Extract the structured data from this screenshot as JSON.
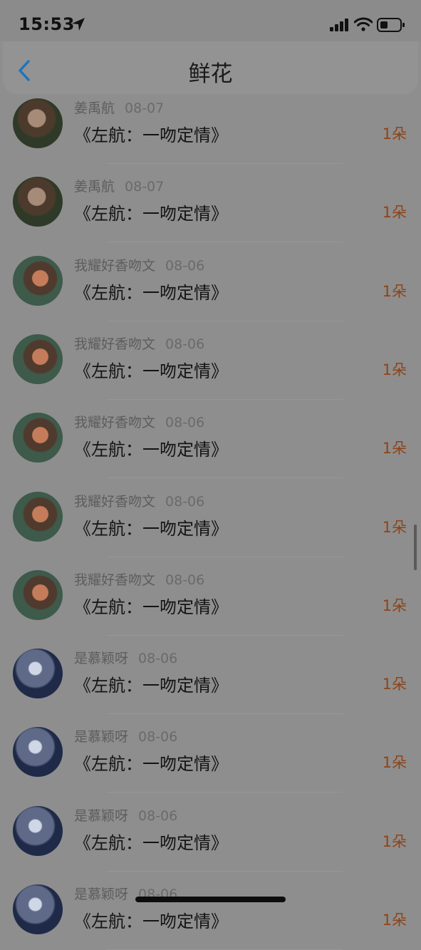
{
  "status_bar": {
    "time": "15:53"
  },
  "nav": {
    "title": "鲜花"
  },
  "rows": [
    {
      "user": "姜禹航",
      "date": "08-07",
      "title": "《左航：一吻定情》",
      "count": "1朵",
      "avatar": "girl"
    },
    {
      "user": "姜禹航",
      "date": "08-07",
      "title": "《左航：一吻定情》",
      "count": "1朵",
      "avatar": "girl"
    },
    {
      "user": "我耀好香吻文",
      "date": "08-06",
      "title": "《左航：一吻定情》",
      "count": "1朵",
      "avatar": "man"
    },
    {
      "user": "我耀好香吻文",
      "date": "08-06",
      "title": "《左航：一吻定情》",
      "count": "1朵",
      "avatar": "man"
    },
    {
      "user": "我耀好香吻文",
      "date": "08-06",
      "title": "《左航：一吻定情》",
      "count": "1朵",
      "avatar": "man"
    },
    {
      "user": "我耀好香吻文",
      "date": "08-06",
      "title": "《左航：一吻定情》",
      "count": "1朵",
      "avatar": "man"
    },
    {
      "user": "我耀好香吻文",
      "date": "08-06",
      "title": "《左航：一吻定情》",
      "count": "1朵",
      "avatar": "man"
    },
    {
      "user": "是慕颖呀",
      "date": "08-06",
      "title": "《左航：一吻定情》",
      "count": "1朵",
      "avatar": "blue"
    },
    {
      "user": "是慕颖呀",
      "date": "08-06",
      "title": "《左航：一吻定情》",
      "count": "1朵",
      "avatar": "blue"
    },
    {
      "user": "是慕颖呀",
      "date": "08-06",
      "title": "《左航：一吻定情》",
      "count": "1朵",
      "avatar": "blue"
    },
    {
      "user": "是慕颖呀",
      "date": "08-06",
      "title": "《左航：一吻定情》",
      "count": "1朵",
      "avatar": "blue"
    }
  ]
}
